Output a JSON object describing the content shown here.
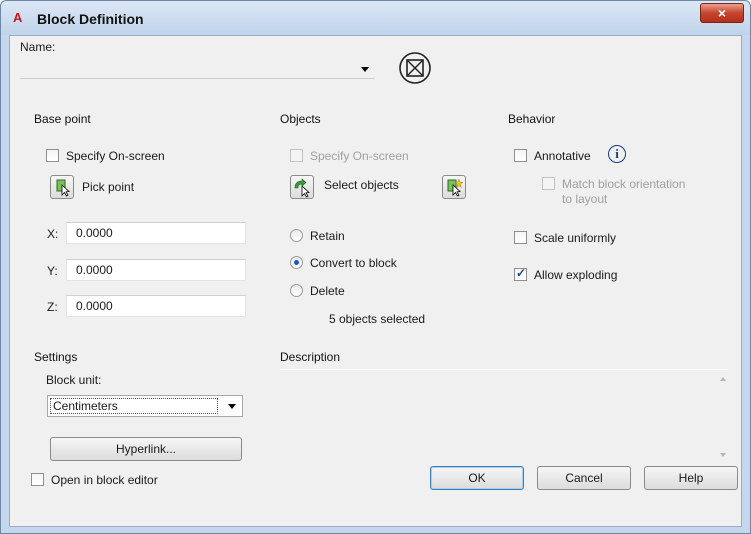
{
  "window": {
    "app_logo": "A",
    "title": "Block Definition",
    "close_glyph": "×"
  },
  "name": {
    "label": "Name:",
    "value": ""
  },
  "base_point": {
    "title": "Base point",
    "specify_on_screen": "Specify On-screen",
    "pick_point": "Pick point",
    "x_label": "X:",
    "x_value": "0.0000",
    "y_label": "Y:",
    "y_value": "0.0000",
    "z_label": "Z:",
    "z_value": "0.0000"
  },
  "objects": {
    "title": "Objects",
    "specify_on_screen": "Specify On-screen",
    "select_objects": "Select objects",
    "retain": "Retain",
    "convert_to_block": "Convert to block",
    "delete": "Delete",
    "selected_count": "5 objects selected",
    "selected_option": "convert_to_block"
  },
  "behavior": {
    "title": "Behavior",
    "annotative": "Annotative",
    "annotative_checked": false,
    "info_glyph": "i",
    "match_orientation_1": "Match block orientation",
    "match_orientation_2": "to layout",
    "scale_uniformly": "Scale uniformly",
    "scale_uniformly_checked": false,
    "allow_exploding": "Allow exploding",
    "allow_exploding_checked": true
  },
  "settings": {
    "title": "Settings",
    "block_unit_label": "Block unit:",
    "block_unit_value": "Centimeters",
    "hyperlink": "Hyperlink..."
  },
  "description": {
    "title": "Description",
    "value": ""
  },
  "footer": {
    "open_in_block_editor": "Open in block editor",
    "open_in_block_editor_checked": false,
    "ok": "OK",
    "cancel": "Cancel",
    "help": "Help"
  },
  "colors": {
    "titlebar": "#c5d7ec",
    "client": "#f0f0f0",
    "accent": "#1b56c4",
    "close": "#c7442e"
  }
}
